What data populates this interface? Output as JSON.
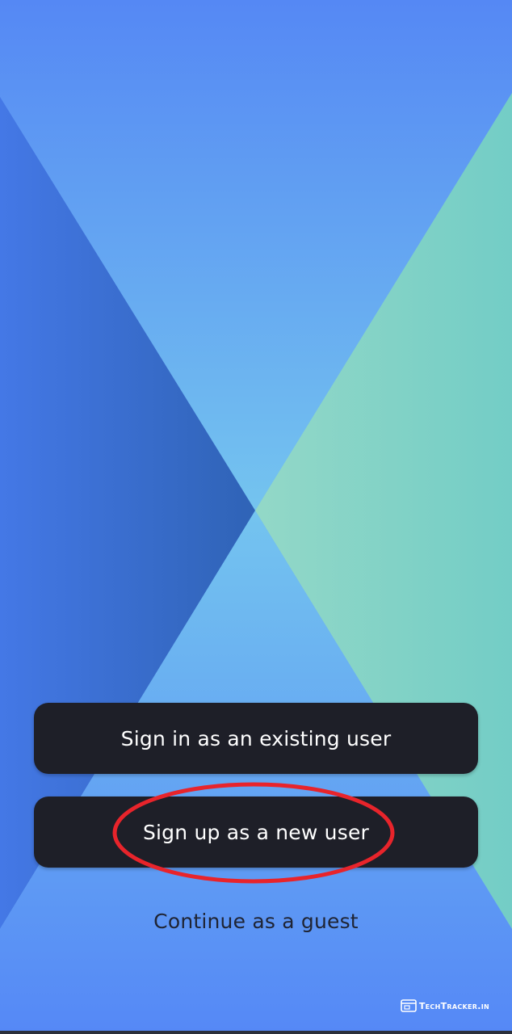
{
  "actions": {
    "sign_in_label": "Sign in as an existing user",
    "sign_up_label": "Sign up as a new user",
    "guest_label": "Continue as a guest"
  },
  "watermark": {
    "text": "TechTracker.in",
    "icon": "browser-window-icon"
  },
  "colors": {
    "button_bg": "#1e1f28",
    "button_text": "#ffffff",
    "guest_text": "#1f2433",
    "annotation_ring": "#e8242b",
    "bg_top": "#5588f4",
    "bg_center": "#72c1ee",
    "bg_left": "#3f6ed8",
    "bg_right": "#7dd0c2"
  }
}
